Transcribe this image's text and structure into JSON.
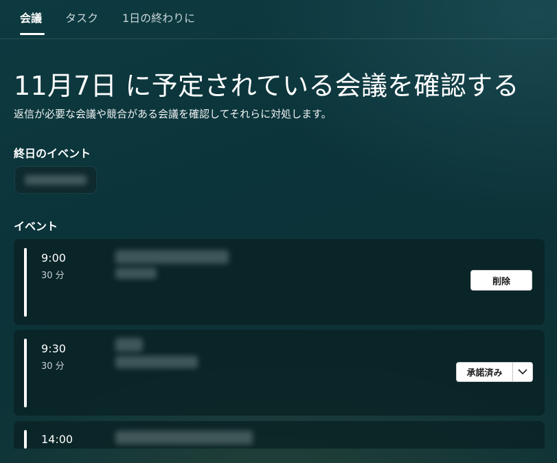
{
  "tabs": [
    {
      "label": "会議",
      "active": true
    },
    {
      "label": "タスク",
      "active": false
    },
    {
      "label": "1日の終わりに",
      "active": false
    }
  ],
  "header": {
    "title": "11月7日 に予定されている会議を確認する",
    "subtitle": "返信が必要な会議や競合がある会議を確認してそれらに対処します。"
  },
  "sections": {
    "all_day": "終日のイベント",
    "events": "イベント"
  },
  "events": [
    {
      "time": "9:00",
      "duration": "30 分",
      "action_label": "削除"
    },
    {
      "time": "9:30",
      "duration": "30 分",
      "action_label": "承諾済み"
    },
    {
      "time": "14:00"
    }
  ],
  "icons": {
    "dropdown": "chevron-down-icon"
  }
}
